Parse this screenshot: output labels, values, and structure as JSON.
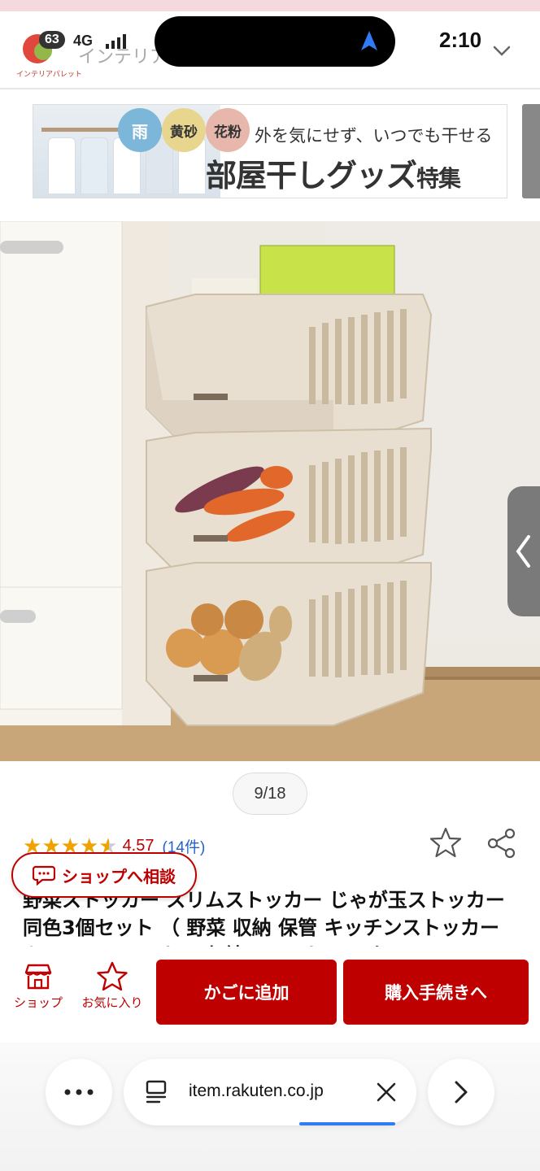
{
  "status": {
    "notification_count": "63",
    "network": "4G",
    "time": "2:10"
  },
  "header": {
    "shop_logo_text": "インテリアパレット",
    "shop_name_partial": "インテリア"
  },
  "banner": {
    "badges": [
      "雨",
      "黄砂",
      "花粉"
    ],
    "subtitle": "外を気にせず、いつでも干せる",
    "title": "部屋干しグッズ",
    "title_suffix": "特集"
  },
  "gallery": {
    "counter": "9/18"
  },
  "rating": {
    "value": "4.57",
    "count": "(14件)",
    "stars_filled": 4.57
  },
  "consult_button": {
    "label": "ショップへ相談"
  },
  "product": {
    "title": "野菜ストッカー スリムストッカー じゃが玉ストッカー 同色3個セット （ 野菜 収納 保管 キッチンストッカー キッチンストッカー 収納ストッカー スタッ"
  },
  "actions": {
    "shop_label": "ショップ",
    "favorite_label": "お気に入り",
    "cart_label": "かごに追加",
    "buy_label": "購入手続きへ"
  },
  "browser": {
    "url": "item.rakuten.co.jp"
  },
  "colors": {
    "brand_red": "#bf0000",
    "star": "#f0a300",
    "link_blue": "#2563c9"
  }
}
